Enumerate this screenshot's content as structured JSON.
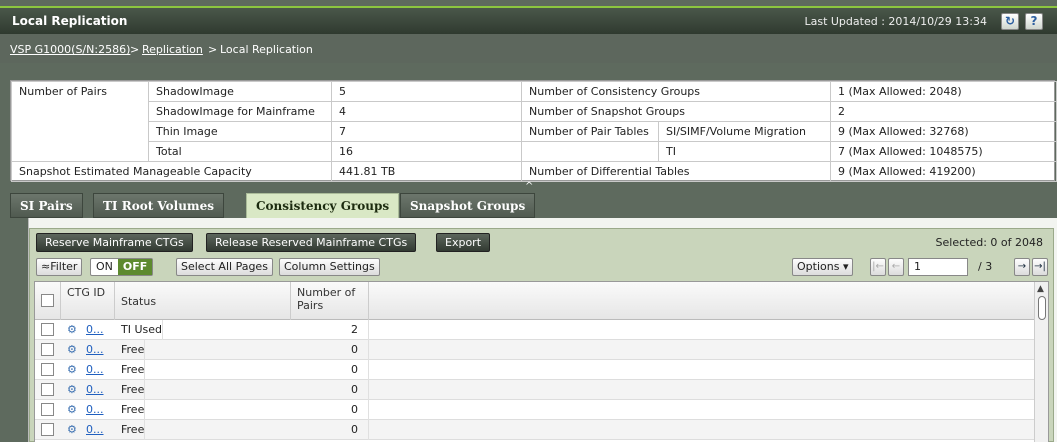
{
  "window": {
    "title": "Local Replication",
    "last_updated": "Last Updated : 2014/10/29 13:34",
    "refresh_icon": "refresh-icon",
    "help_label": "?"
  },
  "breadcrumb": {
    "system": "VSP G1000(S/N:2586)",
    "sep1": ">",
    "replication": "Replication",
    "sep2": ">",
    "current": "Local Replication"
  },
  "summary": {
    "number_of_pairs": "Number of Pairs",
    "shadowimage_label": "ShadowImage",
    "shadowimage_value": "5",
    "si_mainframe_label": "ShadowImage for Mainframe",
    "si_mainframe_value": "4",
    "thin_image_label": "Thin Image",
    "thin_image_value": "7",
    "total_label": "Total",
    "total_value": "16",
    "snapshot_capacity_label": "Snapshot Estimated Manageable Capacity",
    "snapshot_capacity_value": "441.81 TB",
    "consistency_groups_label": "Number of Consistency Groups",
    "consistency_groups_value": "1 (Max Allowed: 2048)",
    "snapshot_groups_label": "Number of Snapshot Groups",
    "snapshot_groups_value": "2",
    "pair_tables_label": "Number of Pair Tables",
    "pair_tables_si_label": "SI/SIMF/Volume Migration",
    "pair_tables_si_value": "9 (Max Allowed: 32768)",
    "pair_tables_ti_label": "TI",
    "pair_tables_ti_value": "7 (Max Allowed: 1048575)",
    "differential_tables_label": "Number of Differential Tables",
    "differential_tables_value": "9 (Max Allowed: 419200)"
  },
  "tabs": [
    {
      "label": "SI Pairs",
      "active": false
    },
    {
      "label": "TI Root Volumes",
      "active": false
    },
    {
      "label": "Consistency Groups",
      "active": true
    },
    {
      "label": "Snapshot Groups",
      "active": false
    }
  ],
  "actions": {
    "reserve": "Reserve Mainframe CTGs",
    "release": "Release Reserved Mainframe CTGs",
    "export": "Export",
    "selected": "Selected:  0   of 2048"
  },
  "toolbar": {
    "filter": "≈Filter",
    "on": "ON",
    "off": "OFF",
    "select_all_pages": "Select All Pages",
    "column_settings": "Column Settings",
    "options": "Options ▾",
    "page_value": "1",
    "page_total": "/ 3"
  },
  "columns": {
    "ctg_id": "CTG ID",
    "status": "Status",
    "number_of_pairs": "Number of Pairs"
  },
  "rows": [
    {
      "ctg": "0...",
      "status": "TI Used",
      "pairs": "2"
    },
    {
      "ctg": "0...",
      "status": "Free",
      "pairs": "0"
    },
    {
      "ctg": "0...",
      "status": "Free",
      "pairs": "0"
    },
    {
      "ctg": "0...",
      "status": "Free",
      "pairs": "0"
    },
    {
      "ctg": "0...",
      "status": "Free",
      "pairs": "0"
    },
    {
      "ctg": "0...",
      "status": "Free",
      "pairs": "0"
    }
  ],
  "colors": {
    "accent": "#8cc63f",
    "active_tab": "#d9e8c5",
    "link": "#1f5fbf"
  }
}
